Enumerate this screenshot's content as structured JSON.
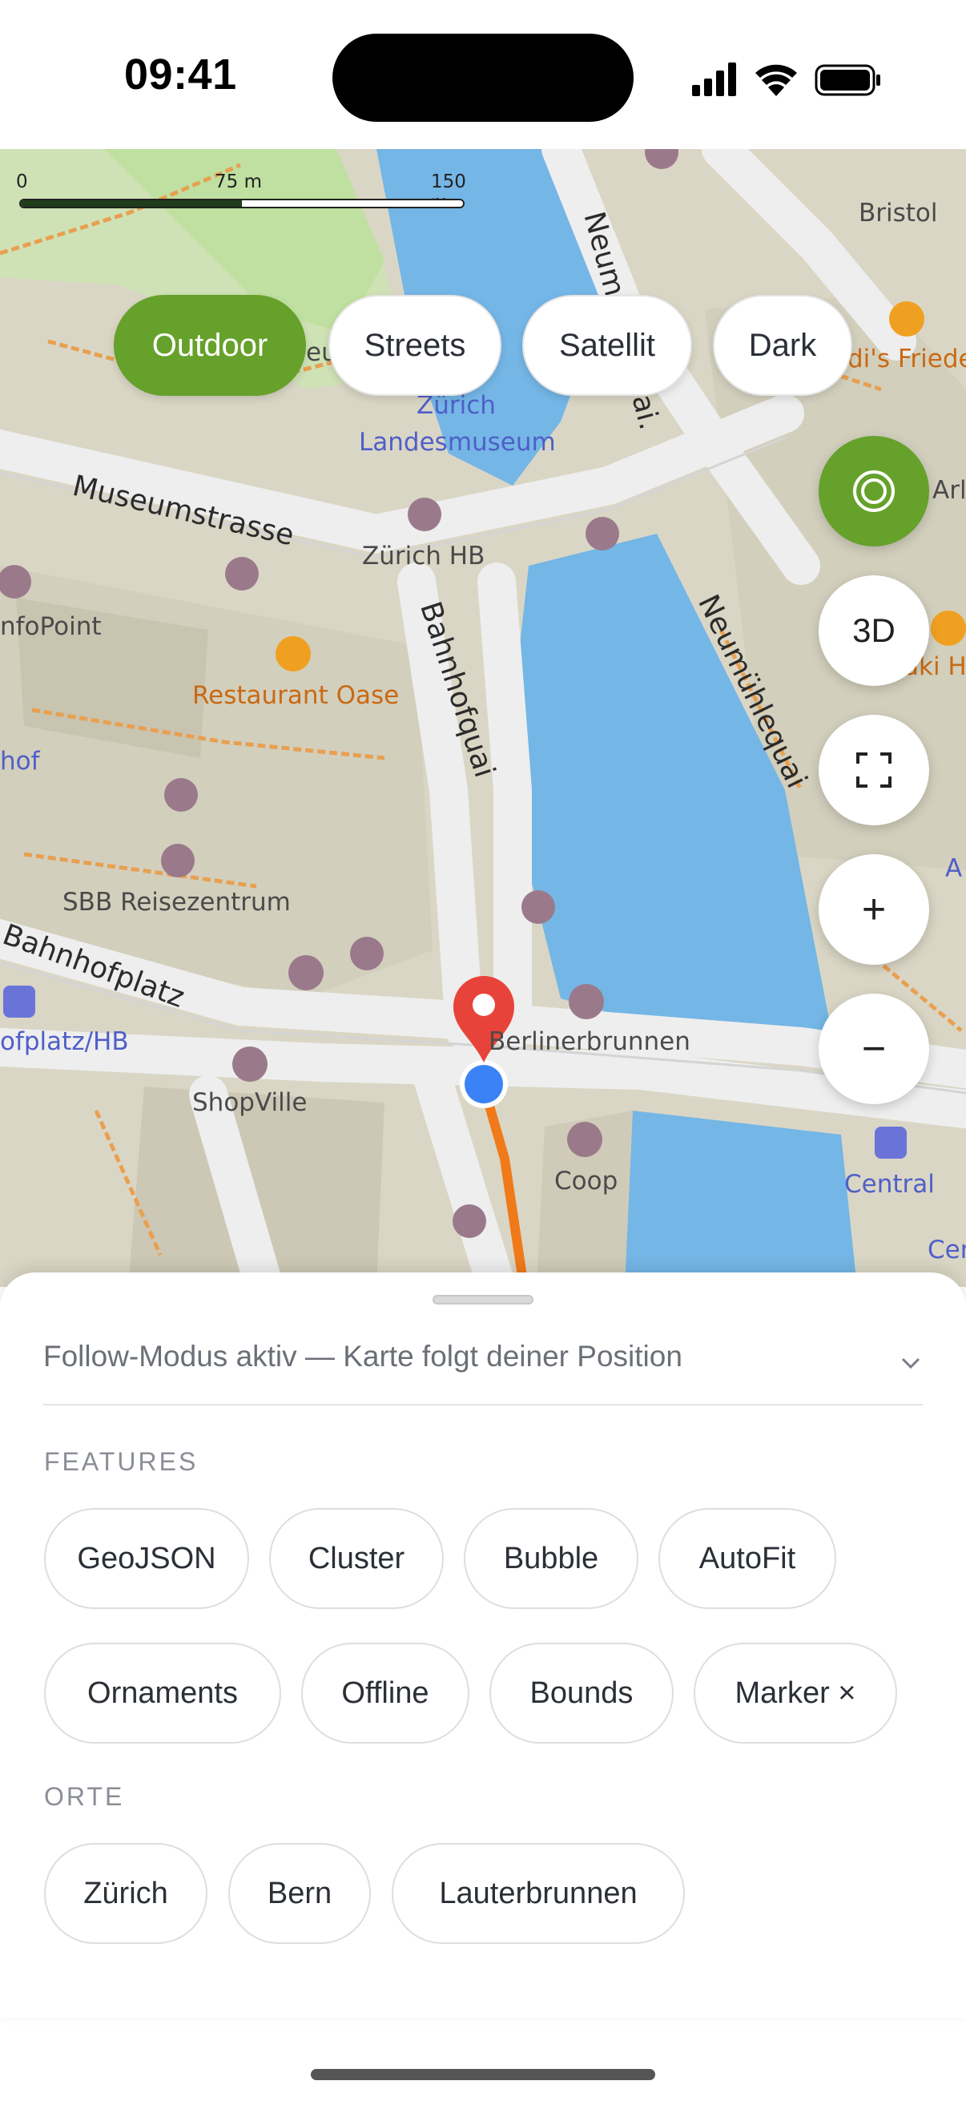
{
  "status_bar": {
    "time": "09:41"
  },
  "map": {
    "scale": {
      "tick_0": "0",
      "tick_mid": "75 m",
      "tick_end": "150 m"
    },
    "style_pills": [
      {
        "label": "Outdoor",
        "active": true
      },
      {
        "label": "Streets",
        "active": false
      },
      {
        "label": "Satellit",
        "active": false
      },
      {
        "label": "Dark",
        "active": false
      }
    ],
    "controls": {
      "three_d": "3D",
      "zoom_in": "+",
      "zoom_out": "−"
    },
    "labels": {
      "museumstrasse": "Museumstrasse",
      "bahnhofquai": "Bahnhofquai",
      "neumuehlequai": "Neumühlequai",
      "neum_top": "Neum",
      "quai": "ai.",
      "rasse": "rasse",
      "bahnhofplatz": "Bahnhofplatz",
      "landesmuseum_1": "Zürich",
      "landesmuseum_2": "Landesmuseum",
      "zurich_hb": "Zürich HB",
      "restaurant": "Restaurant Oase",
      "sbb": "SBB Reisezentrum",
      "shopville": "ShopVille",
      "coop": "Coop",
      "berlinerbrunnen": "Berlinerbrunnen",
      "central": "Central",
      "cen": "Cen",
      "bristol": "Bristol",
      "infopoint": "nfoPoint",
      "hof": "hof",
      "ofplatz": "ofplatz/HB",
      "eu": "eu",
      "friede": "di's Friede",
      "arl": "Arl",
      "aki": "aki H",
      "a_right": "A"
    },
    "accent_color": "#66a12b",
    "route_color": "#f07a1a",
    "marker_color": "#e8433a",
    "location_color": "#3b82f6"
  },
  "sheet": {
    "status_text": "Follow-Modus aktiv — Karte folgt deiner Position",
    "features_title": "FEATURES",
    "features": [
      "GeoJSON",
      "Cluster",
      "Bubble",
      "AutoFit",
      "Ornaments",
      "Offline",
      "Bounds",
      "Marker ×"
    ],
    "places_title": "ORTE",
    "places": [
      "Zürich",
      "Bern",
      "Lauterbrunnen"
    ]
  }
}
